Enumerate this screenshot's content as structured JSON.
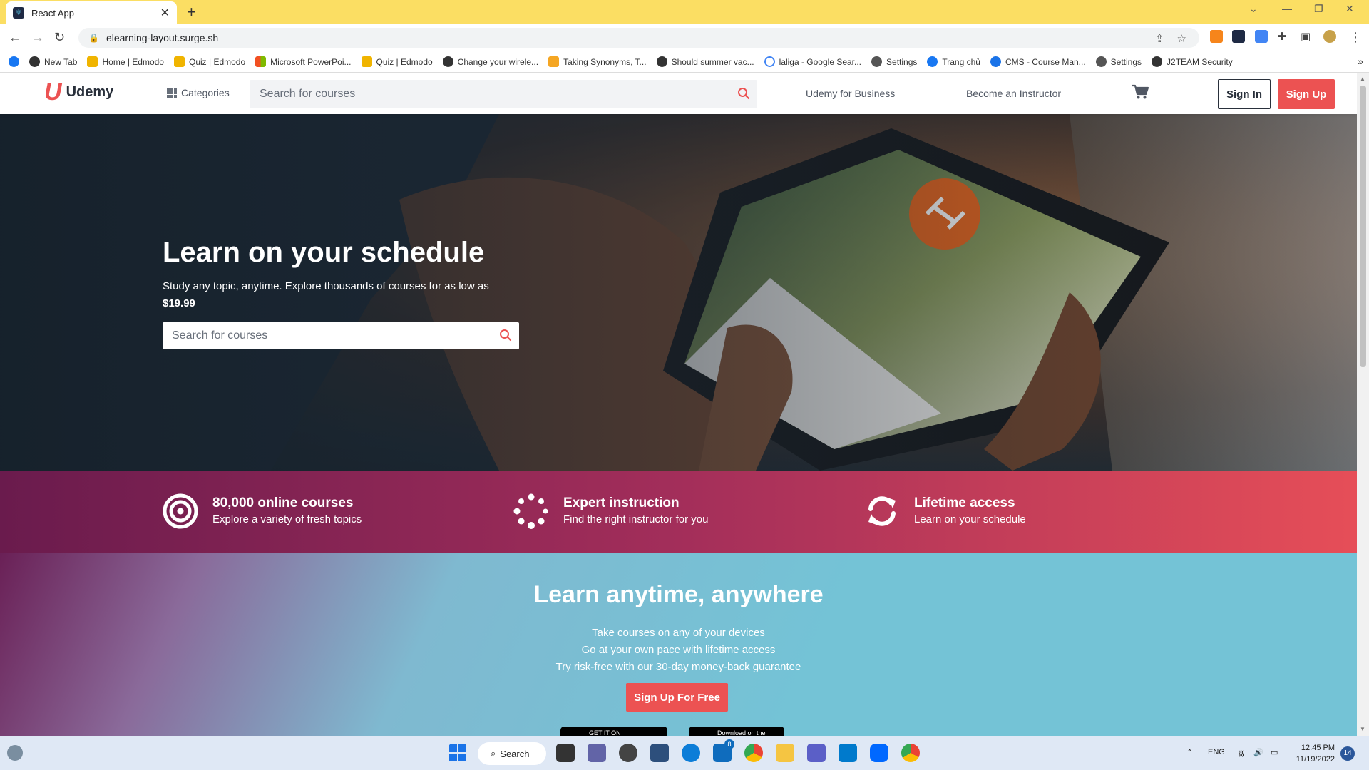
{
  "browser": {
    "tab_title": "React App",
    "url": "elearning-layout.surge.sh",
    "bookmarks": [
      {
        "label": "New Tab",
        "color": "#333333"
      },
      {
        "label": "Home | Edmodo",
        "color": "#f0b400"
      },
      {
        "label": "Quiz | Edmodo",
        "color": "#f0b400"
      },
      {
        "label": "Microsoft PowerPoi...",
        "color": "#f25022"
      },
      {
        "label": "Quiz | Edmodo",
        "color": "#f0b400"
      },
      {
        "label": "Change your wirele...",
        "color": "#333333"
      },
      {
        "label": "Taking Synonyms, T...",
        "color": "#f5a623"
      },
      {
        "label": "Should summer vac...",
        "color": "#333333"
      },
      {
        "label": "laliga - Google Sear...",
        "color": "#4285f4"
      },
      {
        "label": "Settings",
        "color": "#555555"
      },
      {
        "label": "Trang chủ",
        "color": "#1877f2"
      },
      {
        "label": "CMS - Course Man...",
        "color": "#1a73e8"
      },
      {
        "label": "Settings",
        "color": "#555555"
      },
      {
        "label": "J2TEAM Security",
        "color": "#333333"
      }
    ]
  },
  "header": {
    "logo_text": "Udemy",
    "categories_label": "Categories",
    "search_placeholder": "Search for courses",
    "business_link": "Udemy for Business",
    "instructor_link": "Become an Instructor",
    "signin_label": "Sign In",
    "signup_label": "Sign Up",
    "accent_color": "#ec5252"
  },
  "hero": {
    "title": "Learn on your schedule",
    "subtitle": "Study any topic, anytime. Explore thousands of courses for as low as",
    "price": "$19.99",
    "search_placeholder": "Search for courses"
  },
  "features": [
    {
      "icon": "target-icon",
      "title": "80,000 online courses",
      "desc": "Explore a variety of fresh topics"
    },
    {
      "icon": "spinner-icon",
      "title": "Expert instruction",
      "desc": "Find the right instructor for you"
    },
    {
      "icon": "refresh-icon",
      "title": "Lifetime access",
      "desc": "Learn on your schedule"
    }
  ],
  "anywhere": {
    "title": "Learn anytime, anywhere",
    "lines": [
      "Take courses on any of your devices",
      "Go at your own pace with lifetime access",
      "Try risk-free with our 30-day money-back guarantee"
    ],
    "cta_label": "Sign Up For Free",
    "google_play": "GET IT ON",
    "app_store": "Download on the"
  },
  "taskbar": {
    "search_label": "Search",
    "language": "ENG",
    "time": "12:45 PM",
    "date": "11/19/2022",
    "notifications": "14",
    "mail_badge": "8"
  }
}
